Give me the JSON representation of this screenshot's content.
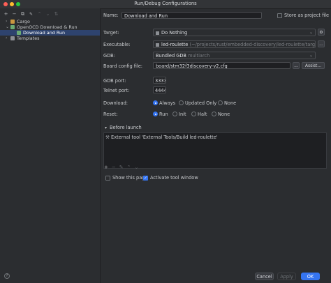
{
  "window": {
    "title": "Run/Debug Configurations",
    "traffic": [
      "#ff5f57",
      "#febc2e",
      "#28c840"
    ]
  },
  "toolbar": {
    "icons": [
      "add-icon",
      "remove-icon",
      "copy-icon",
      "wrench-icon",
      "move-up-icon",
      "move-down-icon",
      "sort-icon"
    ],
    "glyphs": [
      "+",
      "−",
      "⧉",
      "🔧",
      "⌃",
      "⌄",
      "⇅"
    ]
  },
  "tree": [
    {
      "label": "Cargo",
      "arrow": "›",
      "level": 0,
      "icon": "#c9973f"
    },
    {
      "label": "OpenOCD Download & Run",
      "arrow": "⌄",
      "level": 0,
      "icon": "#6aab73"
    },
    {
      "label": "Download and Run",
      "arrow": "",
      "level": 1,
      "icon": "#6aab73",
      "selected": true
    },
    {
      "label": "Templates",
      "arrow": "›",
      "level": 0,
      "icon": "#8c8f94"
    }
  ],
  "form": {
    "name_label": "Name:",
    "name_value": "Download and Run",
    "store_label": "Store as project file",
    "target_label": "Target:",
    "target_value": "Do Nothing",
    "executable_label": "Executable:",
    "executable_name": "led-roulette",
    "executable_path": "(~/projects/rust/embedded-discovery/led-roulette/target/thumbv",
    "gdb_label": "GDB:",
    "gdb_value": "Bundled GDB",
    "gdb_hint": "multiarch",
    "board_label": "Board config file:",
    "board_value": "board/stm32f3discovery-v2.cfg",
    "assist_label": "Assist...",
    "ellipsis": "...",
    "gdb_port_label": "GDB port:",
    "gdb_port_value": "3333",
    "telnet_port_label": "Telnet port:",
    "telnet_port_value": "4444",
    "download_label": "Download:",
    "download_options": [
      "Always",
      "Updated Only",
      "None"
    ],
    "download_selected": 0,
    "reset_label": "Reset:",
    "reset_options": [
      "Run",
      "Init",
      "Halt",
      "None"
    ],
    "reset_selected": 0
  },
  "before_launch": {
    "title": "Before launch",
    "arrow": "▾",
    "task": "External tool 'External Tools/Build led-roulette'",
    "tools": [
      "+",
      "−",
      "✎",
      "⌃",
      "⌄"
    ],
    "show_page_label": "Show this page",
    "show_page_checked": false,
    "activate_label": "Activate tool window",
    "activate_checked": true
  },
  "buttons": {
    "cancel": "Cancel",
    "apply": "Apply",
    "ok": "OK",
    "help": "?"
  },
  "colors": {
    "accent": "#3574f0",
    "selection": "#2e436e"
  }
}
